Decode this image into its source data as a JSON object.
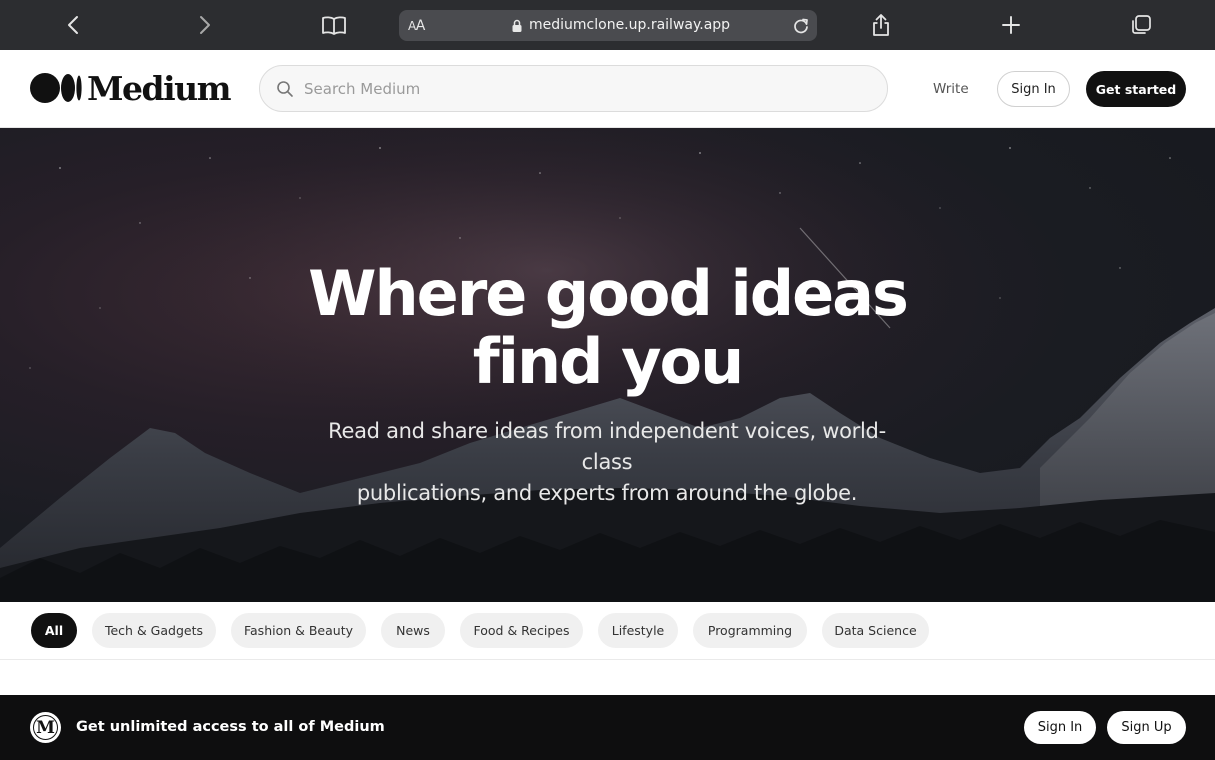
{
  "browser": {
    "text_size_label_small": "A",
    "text_size_label_large": "A",
    "url": "mediumclone.up.railway.app",
    "icons": [
      "back-icon",
      "forward-icon",
      "reader-icon",
      "lock-icon",
      "reload-icon",
      "share-icon",
      "new-tab-icon",
      "tabs-icon"
    ]
  },
  "header": {
    "logo_text": "Medium",
    "search_placeholder": "Search Medium",
    "write_label": "Write",
    "sign_in_label": "Sign In",
    "get_started_label": "Get started"
  },
  "hero": {
    "title_line1": "Where good ideas",
    "title_line2": "find you",
    "subtitle_line1": "Read and share ideas from independent voices, world-class",
    "subtitle_line2": "publications, and experts from around the globe."
  },
  "categories": [
    {
      "label": "All",
      "active": true
    },
    {
      "label": "Tech & Gadgets",
      "active": false
    },
    {
      "label": "Fashion & Beauty",
      "active": false
    },
    {
      "label": "News",
      "active": false
    },
    {
      "label": "Food & Recipes",
      "active": false
    },
    {
      "label": "Lifestyle",
      "active": false
    },
    {
      "label": "Programming",
      "active": false
    },
    {
      "label": "Data Science",
      "active": false
    }
  ],
  "banner": {
    "logo_letter": "M",
    "text": "Get unlimited access to all of Medium",
    "sign_in_label": "Sign In",
    "sign_up_label": "Sign Up"
  },
  "colors": {
    "chrome": "#2c2d30",
    "accent": "#111111",
    "chip": "#f0f0f0",
    "banner": "#0e0e0f"
  }
}
